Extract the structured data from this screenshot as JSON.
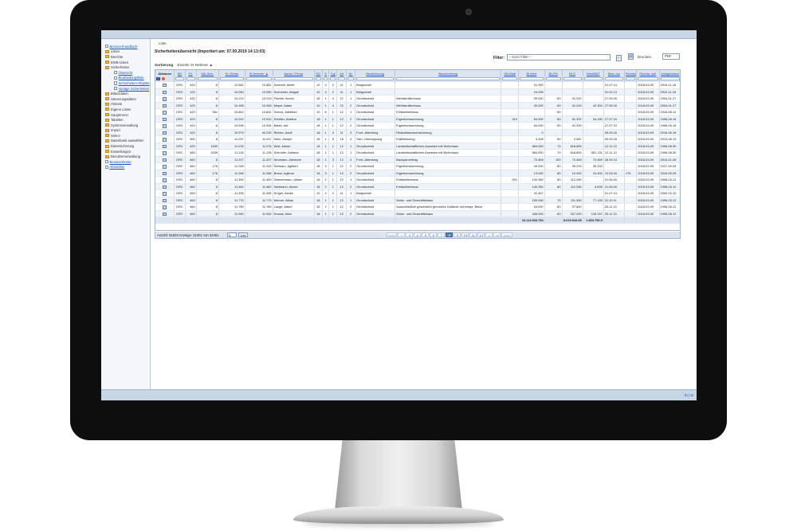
{
  "sidebar": {
    "items": [
      {
        "label": "Benutzerhandbuck",
        "kind": "doc",
        "link": true,
        "level": 0
      },
      {
        "label": "Listen",
        "kind": "folder",
        "level": 0
      },
      {
        "label": "Berichte",
        "kind": "folder",
        "level": 0
      },
      {
        "label": "EWB-Listen",
        "kind": "folder",
        "level": 0
      },
      {
        "label": "Sicherheiten",
        "kind": "folder",
        "level": 0
      },
      {
        "label": "Übersicht",
        "kind": "doc",
        "link": true,
        "level": 1
      },
      {
        "label": "Bearbeitungsliste",
        "kind": "doc",
        "link": true,
        "level": 1
      },
      {
        "label": "Sicherheiten-Objekte",
        "kind": "doc",
        "link": true,
        "level": 1
      },
      {
        "label": "Vorlage Sicherheiten",
        "kind": "doc",
        "link": true,
        "level": 1
      },
      {
        "label": "Bilanzdaten",
        "kind": "folder",
        "level": 0
      },
      {
        "label": "Steuerungsdaten",
        "kind": "folder",
        "level": 0
      },
      {
        "label": "Historie",
        "kind": "folder",
        "level": 0
      },
      {
        "label": "Eigene Listen",
        "kind": "folder",
        "level": 0
      },
      {
        "label": "Hauptmenü",
        "kind": "folder",
        "level": 0
      },
      {
        "label": "Tabellen",
        "kind": "folder",
        "level": 0
      },
      {
        "label": "Systemverwaltung",
        "kind": "folder",
        "level": 0
      },
      {
        "label": "Import",
        "kind": "folder",
        "level": 0
      },
      {
        "label": "Select",
        "kind": "folder",
        "level": 0
      },
      {
        "label": "Datenbank auswählen",
        "kind": "folder",
        "level": 0
      },
      {
        "label": "Datensicherung",
        "kind": "folder",
        "level": 0
      },
      {
        "label": "Einstellungen",
        "kind": "folder",
        "level": 0
      },
      {
        "label": "Benutzerverwaltung",
        "kind": "folder",
        "level": 0
      },
      {
        "label": "Benutzerkonto",
        "kind": "doc",
        "link": true,
        "level": 0
      },
      {
        "label": "Abmelden",
        "kind": "doc",
        "link": true,
        "level": 0
      }
    ]
  },
  "main": {
    "tab_label": "Liste",
    "title": "Sicherheitenübersicht (Importiert am: 07.09.2019 14:13:03)",
    "filter_label": "Filter:",
    "filter_value": "---Kein Filter---",
    "print_label": "Drucken",
    "print_format": "PDF",
    "sort_label": "Sortierung",
    "sort_mode": "Einzeln",
    "sort_field": "SI-Nehmer ▲"
  },
  "table": {
    "columns": [
      "Aktionen",
      "BG",
      "Fil.",
      "MA-Sich.",
      "Si.-Geber",
      "Si-Nehmer ▲",
      "Name / Firma",
      "RG",
      "S",
      "Typ",
      "Art",
      "Nr.",
      "Bezeichnung",
      "Beschreibung",
      "GB-Blatt",
      "Bl.Wert",
      "BLG%",
      "BLG",
      "Wert/BAT",
      "Bew. am",
      "Rechtsw.",
      "Rechtw. seit",
      "Anlagedatum"
    ],
    "rows": [
      [
        "",
        "DRC",
        "420",
        "8",
        "10.681",
        "10.681",
        "Schmidt, Abbie",
        "10",
        "4",
        "2",
        "11",
        "1",
        "Bürgschaft",
        "",
        "",
        "91.000",
        "",
        "",
        "",
        "01.07.14",
        "",
        "2018-03-09",
        "2016-11-16"
      ],
      [
        "",
        "DRC",
        "120",
        "8",
        "10.090",
        "10.090",
        "Schneider, Abigail",
        "10",
        "4",
        "2",
        "11",
        "1",
        "Bürgschaft",
        "",
        "",
        "24.939",
        "",
        "",
        "",
        "01.02.13",
        "",
        "2018-03-09",
        "2019-11-16"
      ],
      [
        "",
        "DRC",
        "420",
        "8",
        "10.219",
        "10.219",
        "Fischer, Achim",
        "18",
        "1",
        "4",
        "21",
        "1",
        "Grundschuld",
        "Mehrfamilienhaus",
        "",
        "39.000",
        "80",
        "31.200",
        "",
        "27.05.00",
        "",
        "2018-03-09",
        "2004-01-27"
      ],
      [
        "",
        "DRC",
        "420",
        "8",
        "10.308",
        "10.308",
        "Meyer, Adam",
        "10",
        "1",
        "4",
        "22",
        "2",
        "Grundschuld",
        "Mehrfamilienhaus",
        "",
        "39.000",
        "80",
        "31.200",
        "42.300",
        "27.05.00",
        "",
        "2018-03-09",
        "2004-01-27"
      ],
      [
        "",
        "DRC",
        "420",
        "561",
        "10.842",
        "10.842",
        "Schulz, Adelfried",
        "10",
        "6",
        "1",
        "12",
        "1",
        "Grundschuld",
        "Einfamilienhaus",
        "",
        "",
        "80",
        "",
        "",
        "",
        "",
        "2018-03-09",
        "2016-08-11"
      ],
      [
        "",
        "DRC",
        "420",
        "8",
        "10.910",
        "10.910",
        "Schäfer, Adelina",
        "18",
        "1",
        "1",
        "12",
        "2",
        "Grundschuld",
        "Eigentumswohnung",
        "310",
        "64.000",
        "80",
        "51.200",
        "34.150",
        "27.07.10",
        "",
        "2018-03-09",
        "1996-05-16"
      ],
      [
        "",
        "DRC",
        "420",
        "8",
        "10.936",
        "10.936",
        "Bauer, Adi",
        "18",
        "1",
        "1",
        "12",
        "2",
        "Grundschuld",
        "Eigentumswohnung",
        "",
        "64.000",
        "80",
        "51.200",
        "",
        "27.07.10",
        "",
        "2018-03-09",
        "1996-05-16"
      ],
      [
        "",
        "DRC",
        "420",
        "8",
        "10.979",
        "44.230",
        "Richter, Adolf",
        "18",
        "1",
        "3",
        "11",
        "3",
        "Ford.-Abtretung",
        "Risikolebensversicherung",
        "",
        "0",
        "",
        "",
        "",
        "09.03.16",
        "",
        "2018-03-09",
        "2016-06-16"
      ],
      [
        "",
        "DRC",
        "900",
        "8",
        "11.037",
        "11.037",
        "Klein, Adolph",
        "18",
        "1",
        "5",
        "16",
        "4",
        "Sich.-Übereignung",
        "Kraftfahrzeug",
        "",
        "4.328",
        "60",
        "2.587",
        "",
        "09.03.16",
        "",
        "2018-03-09",
        "2013-08-13"
      ],
      [
        "",
        "DRC",
        "420",
        "1839",
        "11.076",
        "11.076",
        "Wolf, Adrian",
        "18",
        "1",
        "1",
        "12",
        "1",
        "Grundschuld",
        "Landwirtschaftliches Anwesen mit Wohnhaus",
        "",
        "864.000",
        "70",
        "618.800",
        "",
        "12.11.13",
        "",
        "2018-03-09",
        "1996-08-30"
      ],
      [
        "",
        "DRC",
        "460",
        "1839",
        "11.126",
        "11.126",
        "Schröder, Adriana",
        "18",
        "1",
        "1",
        "12",
        "1",
        "Grundschuld",
        "Landwirtschaftliches Anwesen mit Wohnhaus",
        "",
        "884.000",
        "70",
        "618.800",
        "551.131",
        "12.11.13",
        "",
        "2018-03-09",
        "1996-08-30"
      ],
      [
        "",
        "DRC",
        "460",
        "8",
        "11.207",
        "11.207",
        "Neumann, Adrianne",
        "18",
        "1",
        "3",
        "12",
        "3",
        "Ford.-Abtretung",
        "Bausparvertrag",
        "",
        "70.469",
        "100",
        "70.469",
        "70.469",
        "26.09.10",
        "",
        "2018-03-09",
        "2010-01-05"
      ],
      [
        "",
        "DRC",
        "460",
        "176",
        "11.248",
        "11.249",
        "Schwarz, Agilbert",
        "18",
        "3",
        "1",
        "12",
        "2",
        "Grundschuld",
        "Eigentumswohnung",
        "",
        "49.000",
        "80",
        "39.200",
        "39.200",
        "",
        "",
        "2018-03-09",
        "2017-09-04"
      ],
      [
        "",
        "DRC",
        "460",
        "176",
        "11.266",
        "11.266",
        "Braun, Agilmar",
        "18",
        "3",
        "1",
        "12",
        "2",
        "Grundschuld",
        "Eigentumswohnung",
        "",
        "13.000",
        "80",
        "10.400",
        "10.400",
        "13.03.16",
        "176",
        "2018-03-09",
        "2016-05-26"
      ],
      [
        "",
        "DRC",
        "460",
        "8",
        "11.300",
        "11.300",
        "Zimmermann, Aileen",
        "18",
        "2",
        "1",
        "12",
        "1",
        "Grundschuld",
        "Einfamilienhaus",
        "901",
        "140.350",
        "80",
        "112.280",
        "",
        "21.06.00",
        "",
        "2018-03-09",
        "1996-03-12"
      ],
      [
        "",
        "DRC",
        "460",
        "8",
        "11.460",
        "11.460",
        "Hartmann, Aimee",
        "18",
        "2",
        "1",
        "12",
        "2",
        "Grundschuld",
        "Einfamilienhaus",
        "",
        "140.350",
        "80",
        "112.280",
        "4.839",
        "21.06.00",
        "",
        "2018-03-09",
        "1996-03-12"
      ],
      [
        "",
        "DRC",
        "460",
        "8",
        "11.495",
        "11.495",
        "Krüger, Aimée",
        "10",
        "4",
        "2",
        "11",
        "1",
        "Bürgschaft",
        "",
        "",
        "32.467",
        "",
        "",
        "",
        "01.07.14",
        "",
        "2018-03-09",
        "2009-02-10"
      ],
      [
        "",
        "DRC",
        "460",
        "8",
        "11.770",
        "11.770",
        "Werner, Alban",
        "18",
        "1",
        "1",
        "12",
        "1",
        "Grundschuld",
        "Wohn- und Geschäftshaus",
        "",
        "159.000",
        "70",
        "111.300",
        "77.193",
        "31.10.11",
        "",
        "2018-03-09",
        "1996-03-12"
      ],
      [
        "",
        "DRC",
        "460",
        "8",
        "11.789",
        "11.789",
        "Lange, Albert",
        "18",
        "1",
        "1",
        "12",
        "2",
        "Grundschuld",
        "Ausschließlich gewerblich genutztes Gelände mit entspr. Beba",
        "",
        "63.000",
        "60",
        "37.800",
        "",
        "25.11.13",
        "",
        "2018-03-09",
        "1996-05-12"
      ],
      [
        "",
        "DRC",
        "460",
        "8",
        "11.940",
        "11.940",
        "Krause, Alea",
        "18",
        "1",
        "1",
        "12",
        "2",
        "Grundschuld",
        "Wohn- und Geschäftshaus",
        "",
        "345.000",
        "60",
        "207.000",
        "133.157",
        "25.11.13",
        "",
        "2018-03-09",
        "1996-05-12"
      ]
    ],
    "totals": {
      "bl_wert": "13.114.533.794",
      "blg": "8.619.943.65",
      "wert_bat": "1.803.796.9"
    }
  },
  "footer": {
    "count_text": "Anzahl: 61504 Anzeige: 32401 von 32401",
    "go_value": "8",
    "go_button": "Los",
    "pages": [
      "<<<<",
      "<",
      "3",
      "4",
      "5",
      "6",
      "7",
      "8",
      "9",
      "10",
      "11",
      "12",
      ">",
      ">>",
      ">>>>"
    ],
    "current_page": "8"
  },
  "statusbar": {
    "right_text": "DI | Si"
  }
}
